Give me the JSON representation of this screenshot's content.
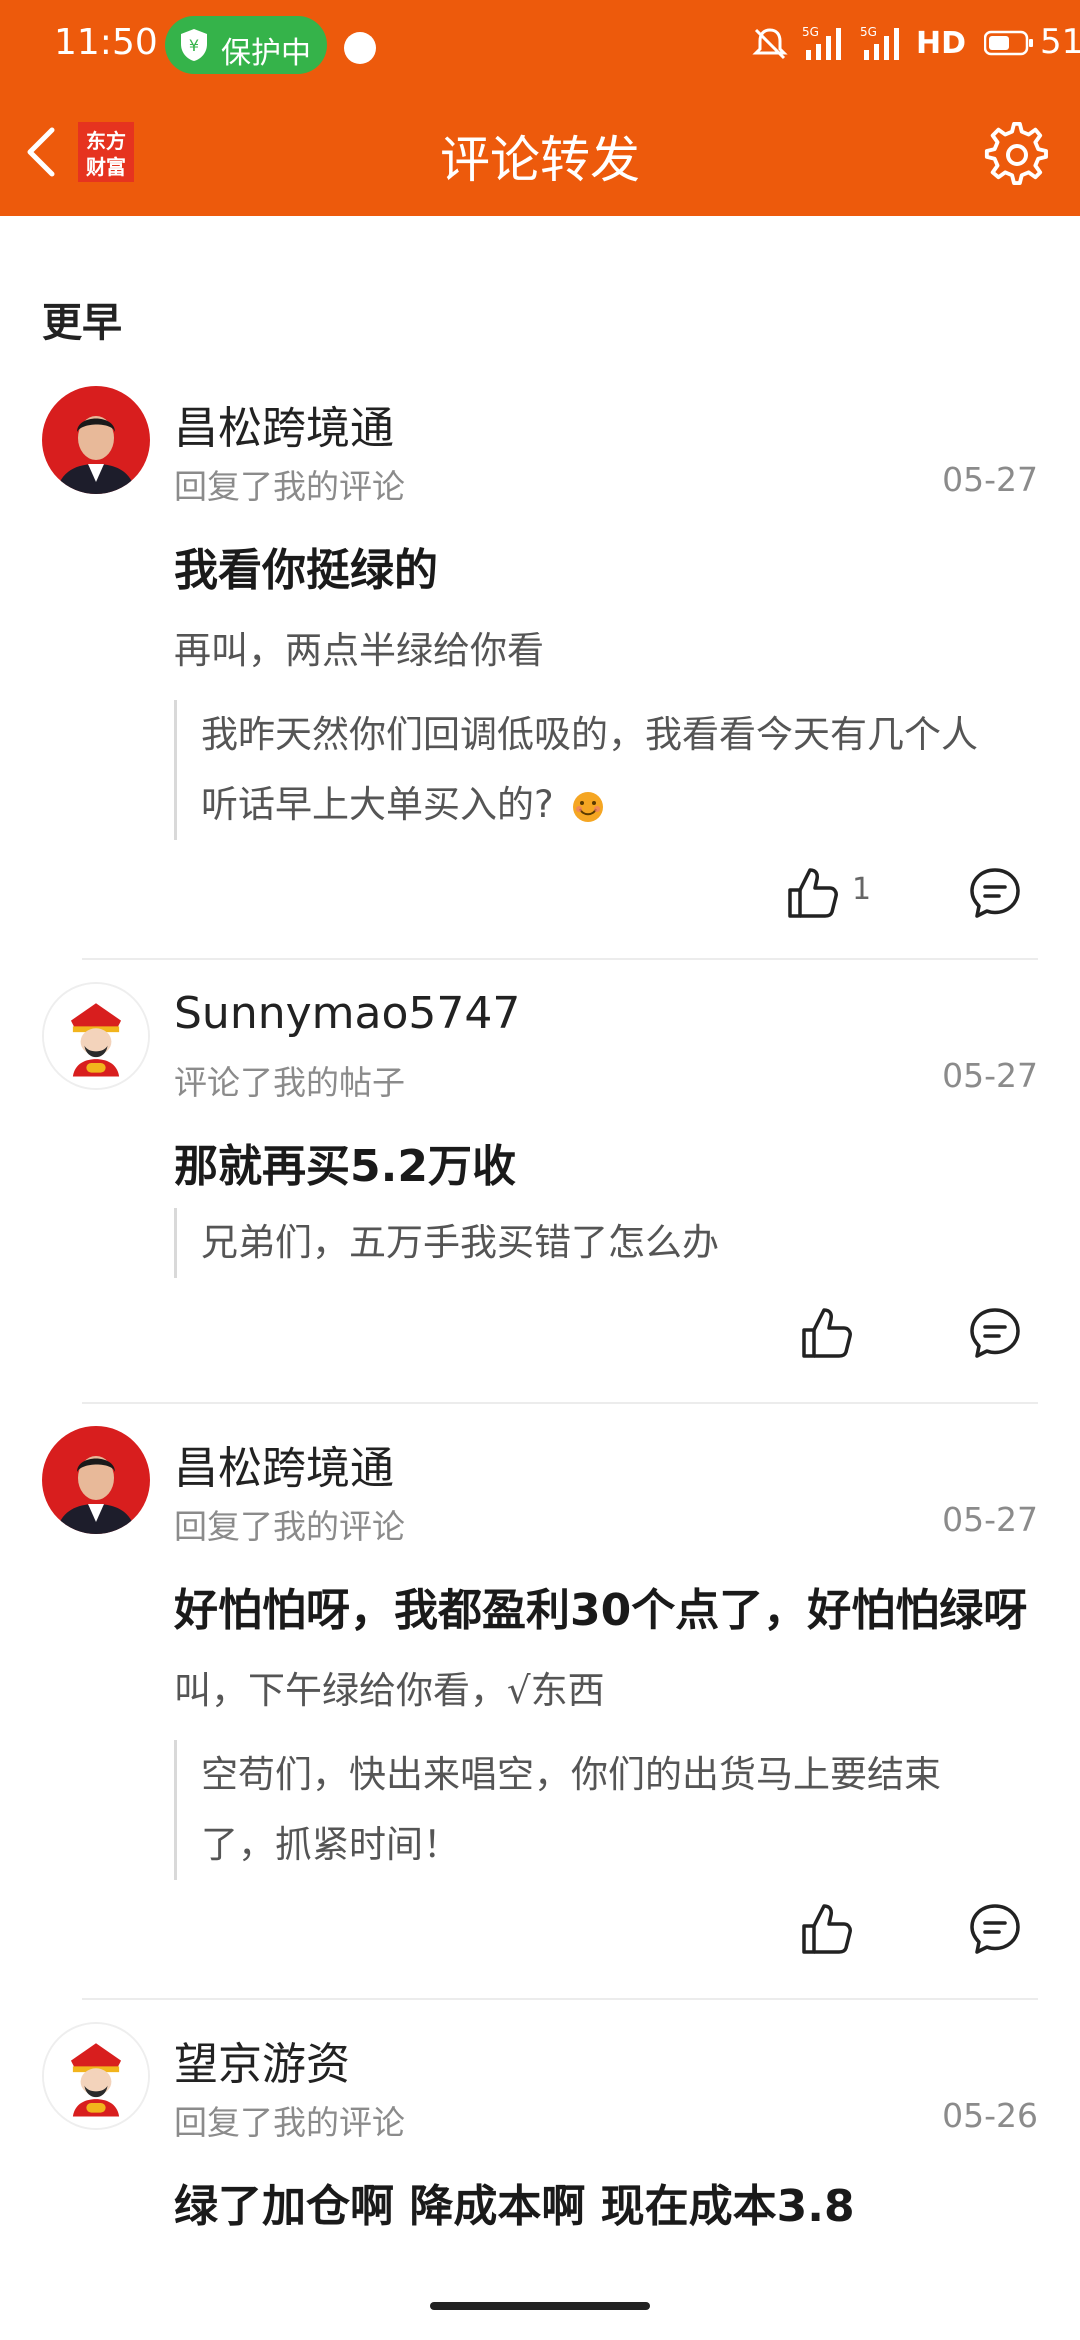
{
  "status_bar": {
    "time": "11:50",
    "shield_text": "保护中",
    "network_label": "HD",
    "battery": "51"
  },
  "nav": {
    "logo_text_1": "东方",
    "logo_text_2": "财富",
    "title": "评论转发"
  },
  "section_label": "更早",
  "items": [
    {
      "username": "昌松跨境通",
      "action": "回复了我的评论",
      "date": "05-27",
      "comment": "我看你挺绿的",
      "reply": "再叫，两点半绿给你看",
      "quote_line1": "我昨天然你们回调低吸的，我看看今天有几个人",
      "quote_line2": "听话早上大单买入的?",
      "like_count": "1"
    },
    {
      "username": "Sunnymao5747",
      "action": "评论了我的帖子",
      "date": "05-27",
      "comment": "那就再买5.2万收",
      "quote_line1": "兄弟们，五万手我买错了怎么办"
    },
    {
      "username": "昌松跨境通",
      "action": "回复了我的评论",
      "date": "05-27",
      "comment": "好怕怕呀，我都盈利30个点了，好怕怕绿呀",
      "reply": "叫，下午绿给你看，√东西",
      "quote_line1": "空苟们，快出来唱空，你们的出货马上要结束",
      "quote_line2": "了，抓紧时间！"
    },
    {
      "username": "望京游资",
      "action": "回复了我的评论",
      "date": "05-26",
      "comment": "绿了加仓啊 降成本啊 现在成本3.8"
    }
  ],
  "colors": {
    "brand_orange": "#ED5A0C",
    "shield_green": "#35B34A"
  }
}
